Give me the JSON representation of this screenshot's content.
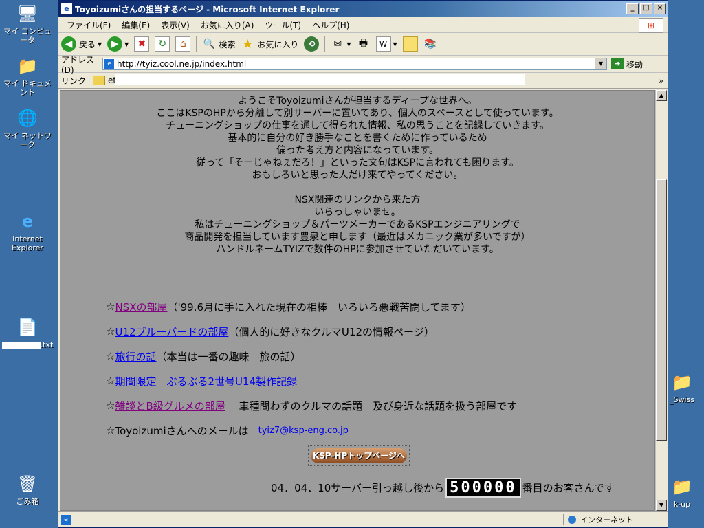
{
  "desktop": {
    "icons": [
      {
        "label": "マイ コンピュータ"
      },
      {
        "label": "マイ ドキュメント"
      },
      {
        "label": "マイ ネットワーク"
      },
      {
        "label": "Internet Explorer"
      },
      {
        "label": ".txt"
      },
      {
        "label": "ごみ箱"
      },
      {
        "label": "_Swiss"
      },
      {
        "label": "k-up"
      }
    ]
  },
  "window": {
    "title": "Toyoizumiさんの担当するページ - Microsoft Internet Explorer",
    "controls": {
      "minimize": "_",
      "maximize": "□",
      "close": "×"
    }
  },
  "menubar": {
    "items": [
      "ファイル(F)",
      "編集(E)",
      "表示(V)",
      "お気に入り(A)",
      "ツール(T)",
      "ヘルプ(H)"
    ]
  },
  "toolbar": {
    "back_label": "戻る",
    "search_label": "検索",
    "favorites_label": "お気に入り"
  },
  "address": {
    "label": "アドレス(D)",
    "url": "http://tyiz.cool.ne.jp/index.html",
    "go_label": "移動"
  },
  "links_bar": {
    "label": "リンク",
    "folder": "etc",
    "chevron": "»"
  },
  "page": {
    "intro_lines": [
      "ようこそToyoizumiさんが担当するディープな世界へ。",
      "ここはKSPのHPから分離して別サーバーに置いてあり、個人のスペースとして使っています。",
      "チューニングショップの仕事を通して得られた情報、私の思うことを記録していきます。",
      "基本的に自分の好き勝手なことを書くために作っているため",
      "偏った考え方と内容になっています。",
      "従って「そーじゃねぇだろ！」といった文句はKSPに言われても困ります。",
      "おもしろいと思った人だけ来てやってください。"
    ],
    "nsx_lines": [
      "NSX関連のリンクから来た方",
      "いらっしゃいませ。",
      "私はチューニングショップ＆パーツメーカーであるKSPエンジニアリングで",
      "商品開発を担当しています豊泉と申します（最近はメカニック業が多いですが）",
      "ハンドルネームTYIZで数件のHPに参加させていただいています。"
    ],
    "star": "☆",
    "links": [
      {
        "link": "NSXの部屋",
        "desc": "（'99.6月に手に入れた現在の相棒　いろいろ悪戦苦闘してます）"
      },
      {
        "link": "U12ブルーバードの部屋",
        "desc": "（個人的に好きなクルマU12の情報ページ）"
      },
      {
        "link": "旅行の話",
        "desc": "（本当は一番の趣味　旅の話）"
      },
      {
        "link": "期間限定　ぶるぶる2世号U14製作記録",
        "desc": ""
      },
      {
        "link": "雑談とB級グルメの部屋",
        "desc": "　 車種問わずのクルマの話題　及び身近な話題を扱う部屋です"
      }
    ],
    "mail_text": "Toyoizumiさんへのメールは",
    "mail_address": "tyiz7@ksp-eng.co.jp",
    "banner_label": "KSP-HPトップページへ",
    "counter_prefix": "04．04．10サーバー引っ越し後から",
    "counter_value": "500000",
    "counter_suffix": "番目のお客さんです"
  },
  "statusbar": {
    "zone": "インターネット"
  },
  "colors": {
    "page_background": "#9c9c9c",
    "visited_link": "#800080",
    "link": "#0000ee",
    "titlebar": "#0a246a"
  }
}
